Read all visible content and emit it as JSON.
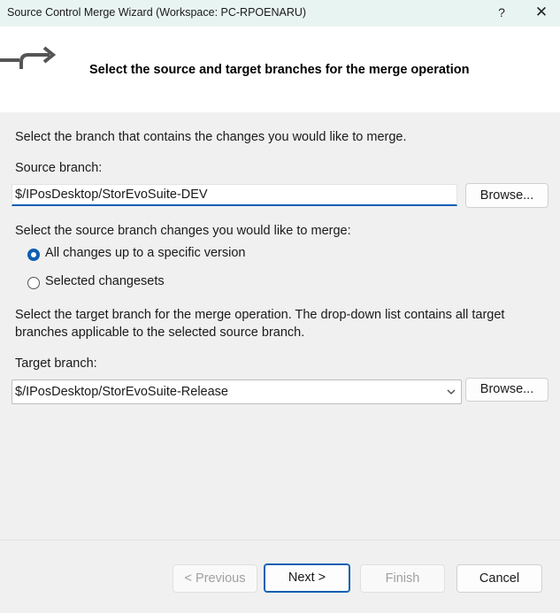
{
  "window": {
    "title": "Source Control Merge Wizard (Workspace: PC-RPOENARU)",
    "help_label": "?",
    "close_label": "✕"
  },
  "header": {
    "heading": "Select the source and target branches for the merge operation",
    "icon": "merge-arrow-icon"
  },
  "source": {
    "intro": "Select the branch that contains the changes you would like to merge.",
    "label": "Source branch:",
    "value": "$/IPosDesktop/StorEvoSuite-DEV",
    "browse_label": "Browse..."
  },
  "changes": {
    "label": "Select the source branch changes you would like to merge:",
    "options": [
      {
        "label": "All changes up to a specific version",
        "checked": true
      },
      {
        "label": "Selected changesets",
        "checked": false
      }
    ]
  },
  "target": {
    "intro_line1": "Select the target branch for the merge operation.  The drop-down list contains all target",
    "intro_line2": "branches applicable to the selected source branch.",
    "label": "Target branch:",
    "value": "$/IPosDesktop/StorEvoSuite-Release",
    "browse_label": "Browse..."
  },
  "footer": {
    "previous_label": "< Previous",
    "next_label": "Next >",
    "finish_label": "Finish",
    "cancel_label": "Cancel"
  },
  "colors": {
    "accent": "#0a5fb4",
    "titlebar_bg": "#e8f4f2",
    "dialog_bg": "#f0f0f0"
  }
}
